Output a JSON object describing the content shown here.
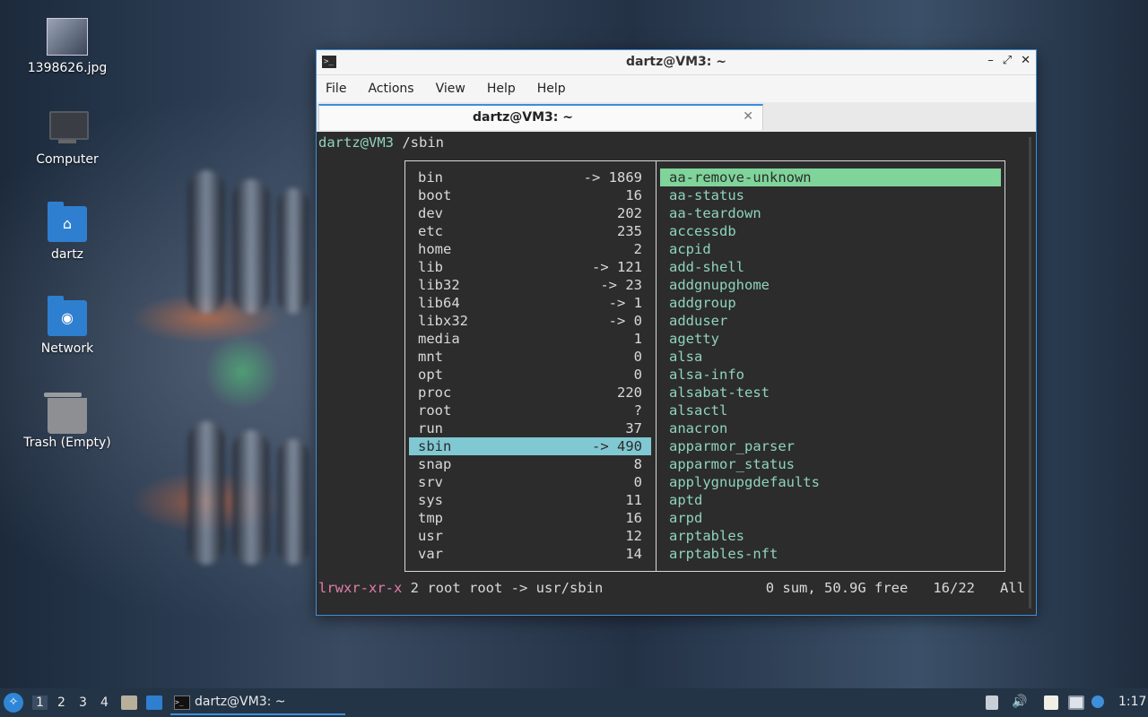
{
  "desktop": {
    "icons": [
      {
        "label": "1398626.jpg",
        "icon": "image-file-icon"
      },
      {
        "label": "Computer",
        "icon": "computer-icon"
      },
      {
        "label": "dartz",
        "icon": "home-folder-icon"
      },
      {
        "label": "Network",
        "icon": "network-folder-icon"
      },
      {
        "label": "Trash (Empty)",
        "icon": "trash-icon"
      }
    ]
  },
  "window": {
    "title": "dartz@VM3: ~",
    "controls": {
      "minimize": "–",
      "maximize": "⤢",
      "close": "✕"
    },
    "menu": [
      "File",
      "Actions",
      "View",
      "Help"
    ],
    "tab": {
      "label": "dartz@VM3: ~",
      "close": "✕"
    }
  },
  "terminal": {
    "prompt_host": "dartz@VM3",
    "prompt_path": " /sbin",
    "left_panel": [
      {
        "name": "bin",
        "size": "-> 1869"
      },
      {
        "name": "boot",
        "size": "16"
      },
      {
        "name": "dev",
        "size": "202"
      },
      {
        "name": "etc",
        "size": "235"
      },
      {
        "name": "home",
        "size": "2"
      },
      {
        "name": "lib",
        "size": "-> 121"
      },
      {
        "name": "lib32",
        "size": "-> 23"
      },
      {
        "name": "lib64",
        "size": "-> 1"
      },
      {
        "name": "libx32",
        "size": "-> 0"
      },
      {
        "name": "media",
        "size": "1"
      },
      {
        "name": "mnt",
        "size": "0"
      },
      {
        "name": "opt",
        "size": "0"
      },
      {
        "name": "proc",
        "size": "220"
      },
      {
        "name": "root",
        "size": "?"
      },
      {
        "name": "run",
        "size": "37"
      },
      {
        "name": "sbin",
        "size": "-> 490"
      },
      {
        "name": "snap",
        "size": "8"
      },
      {
        "name": "srv",
        "size": "0"
      },
      {
        "name": "sys",
        "size": "11"
      },
      {
        "name": "tmp",
        "size": "16"
      },
      {
        "name": "usr",
        "size": "12"
      },
      {
        "name": "var",
        "size": "14"
      }
    ],
    "left_selected": 15,
    "right_panel": [
      "aa-remove-unknown",
      "aa-status",
      "aa-teardown",
      "accessdb",
      "acpid",
      "add-shell",
      "addgnupghome",
      "addgroup",
      "adduser",
      "agetty",
      "alsa",
      "alsa-info",
      "alsabat-test",
      "alsactl",
      "anacron",
      "apparmor_parser",
      "apparmor_status",
      "applygnupgdefaults",
      "aptd",
      "arpd",
      "arptables",
      "arptables-nft"
    ],
    "right_selected": 0,
    "status": {
      "perm": "lrwxr-xr-x",
      "info": " 2 root root -> usr/sbin",
      "right": "0 sum, 50.9G free   16/22   All"
    }
  },
  "taskbar": {
    "workspaces": [
      "1",
      "2",
      "3",
      "4"
    ],
    "active_workspace": "1",
    "task_label": "dartz@VM3: ~",
    "clock": "1:17",
    "tray_icons": [
      "storage-icon",
      "volume-icon",
      "clipboard-icon",
      "network-icon",
      "update-notifier-icon"
    ]
  }
}
